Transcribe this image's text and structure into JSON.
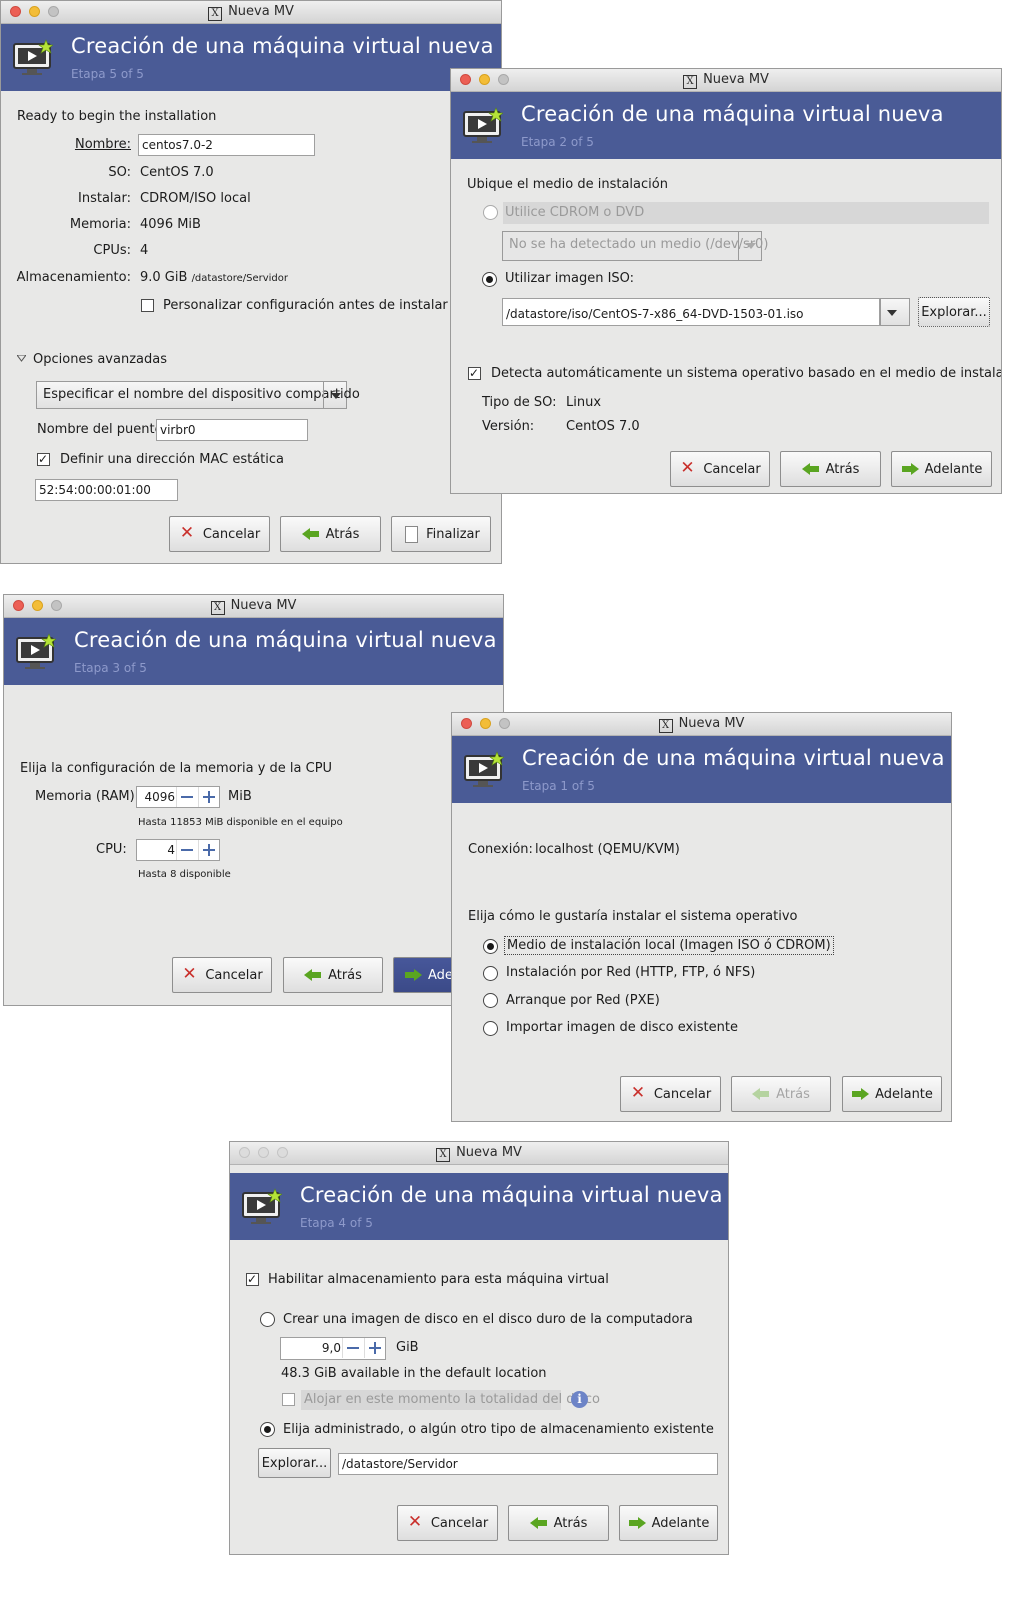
{
  "window_title": "Nueva MV",
  "header_title": "Creación de una máquina virtual nueva",
  "buttons": {
    "cancel": "Cancelar",
    "back": "Atrás",
    "forward": "Adelante",
    "finish": "Finalizar",
    "forward_truncated": "Ade",
    "browse": "Explorar..."
  },
  "step5": {
    "stage": "Etapa 5 of 5",
    "heading": "Ready to begin the installation",
    "name_label": "Nombre:",
    "name_value": "centos7.0-2",
    "os_label": "SO:",
    "os_value": "CentOS 7.0",
    "install_label": "Instalar:",
    "install_value": "CDROM/ISO local",
    "memory_label": "Memoria:",
    "memory_value": "4096 MiB",
    "cpus_label": "CPUs:",
    "cpus_value": "4",
    "storage_label": "Almacenamiento:",
    "storage_value": "9.0 GiB",
    "storage_path": "/datastore/Servidor",
    "customize_label": "Personalizar configuración antes de instalar",
    "customize_checked": false,
    "advanced_label": "Opciones avanzadas",
    "device_combo": "Especificar el nombre del dispositivo compartido",
    "bridge_label": "Nombre del puente:",
    "bridge_value": "virbr0",
    "mac_label": "Definir una dirección MAC estática",
    "mac_checked": true,
    "mac_value": "52:54:00:00:01:00"
  },
  "step2": {
    "stage": "Etapa 2 of 5",
    "heading": "Ubique el medio de instalación",
    "cdrom_label": "Utilice CDROM o DVD",
    "cdrom_combo": "No se ha detectado un medio (/dev/sr0)",
    "iso_label": "Utilizar imagen ISO:",
    "iso_path": "/datastore/iso/CentOS-7-x86_64-DVD-1503-01.iso",
    "detect_label": "Detecta automáticamente un sistema operativo basado en el medio de instalación",
    "detect_checked": true,
    "os_type_label": "Tipo de SO:",
    "os_type_value": "Linux",
    "version_label": "Versión:",
    "version_value": "CentOS 7.0"
  },
  "step3": {
    "stage": "Etapa 3 of 5",
    "heading": "Elija la configuración de la memoria y de la CPU",
    "memory_label": "Memoria (RAM):",
    "memory_value": "4096",
    "memory_unit": "MiB",
    "memory_hint": "Hasta 11853 MiB disponible en el equipo",
    "cpu_label": "CPU:",
    "cpu_value": "4",
    "cpu_hint": "Hasta 8 disponible"
  },
  "step1": {
    "stage": "Etapa 1 of 5",
    "connection_label": "Conexión:",
    "connection_value": "localhost (QEMU/KVM)",
    "heading": "Elija cómo le gustaría instalar el sistema operativo",
    "options": [
      "Medio de instalación local (Imagen ISO ó CDROM)",
      "Instalación por Red (HTTP, FTP, ó NFS)",
      "Arranque por Red (PXE)",
      "Importar imagen de disco existente"
    ],
    "selected_index": 0
  },
  "step4": {
    "stage": "Etapa 4 of 5",
    "enable_label": "Habilitar almacenamiento para esta máquina virtual",
    "enable_checked": true,
    "create_label": "Crear una imagen de disco en el disco duro de la computadora",
    "size_value": "9,0",
    "size_unit": "GiB",
    "available": "48.3 GiB available in the default location",
    "allocate_label": "Alojar en este momento la totalidad del disco",
    "managed_label": "Elija administrado, o algún otro tipo de almacenamiento existente",
    "managed_selected": true,
    "path_value": "/datastore/Servidor"
  },
  "colors": {
    "banner": "#4a5b96",
    "stage_text": "#8e9acb",
    "window_bg": "#e8e8e7",
    "focus_button": "#47579a"
  },
  "icons": [
    "virt-manager-new-vm-icon",
    "x11-window-icon",
    "cancel-icon",
    "back-arrow-icon",
    "forward-arrow-icon",
    "finish-document-icon",
    "info-icon"
  ]
}
